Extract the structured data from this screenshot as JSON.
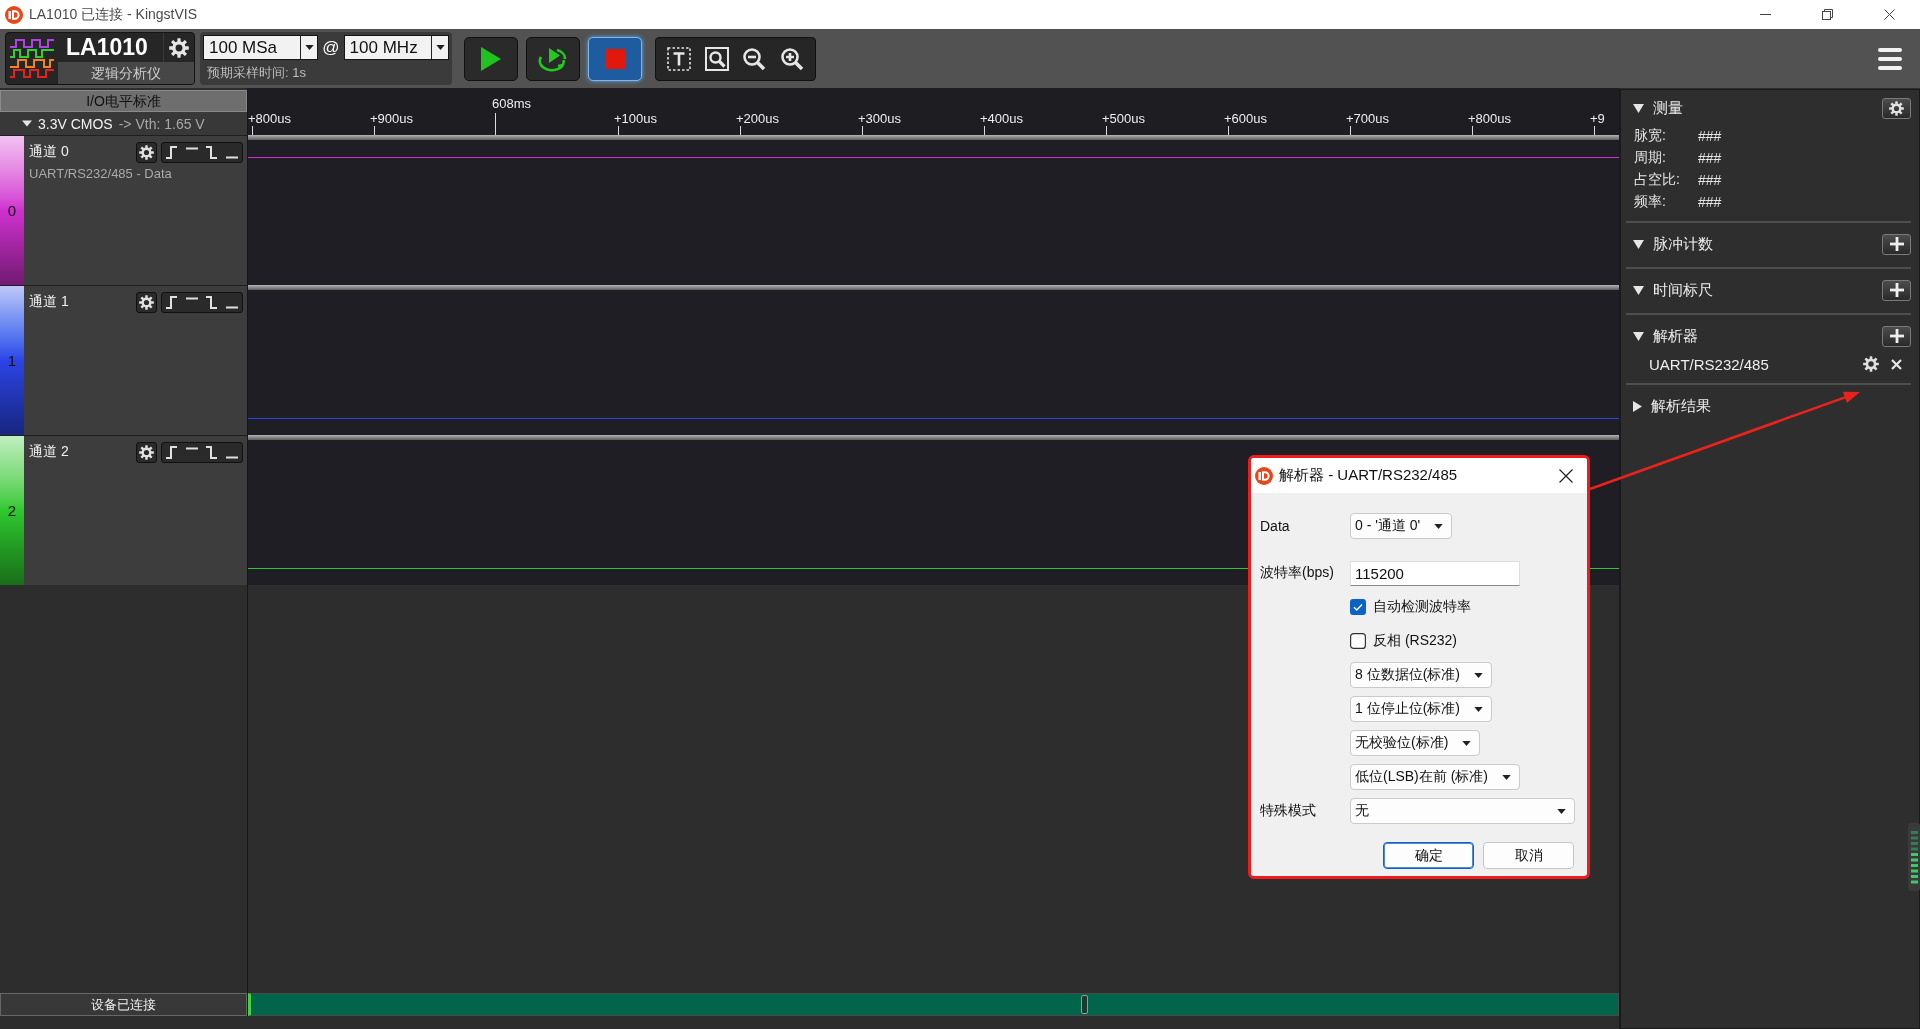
{
  "window": {
    "title": "LA1010 已连接 - KingstVIS"
  },
  "toolbar": {
    "device": "LA1010",
    "device_caption": "逻辑分析仪",
    "sample_depth": "100 MSa",
    "separator": "@",
    "sample_rate": "100 MHz",
    "estimated_time": "预期采样时间: 1s",
    "run_buttons": [
      {
        "kind": "start",
        "active": false
      },
      {
        "kind": "loop",
        "active": false
      },
      {
        "kind": "stop",
        "active": true
      }
    ]
  },
  "io_standard": {
    "title": "I/O电平标准",
    "standard": "3.3V CMOS",
    "threshold": "-> Vth: 1.65 V"
  },
  "ruler": {
    "ticks": [
      {
        "label": "+800us",
        "kind": "minor"
      },
      {
        "label": "+900us",
        "kind": "minor"
      },
      {
        "label": "608ms",
        "kind": "major"
      },
      {
        "label": "+100us",
        "kind": "minor"
      },
      {
        "label": "+200us",
        "kind": "minor"
      },
      {
        "label": "+300us",
        "kind": "minor"
      },
      {
        "label": "+400us",
        "kind": "minor"
      },
      {
        "label": "+500us",
        "kind": "minor"
      },
      {
        "label": "+600us",
        "kind": "minor"
      },
      {
        "label": "+700us",
        "kind": "minor"
      },
      {
        "label": "+800us",
        "kind": "minor"
      },
      {
        "label": "+9",
        "kind": "minor"
      }
    ]
  },
  "channels": [
    {
      "number": "0",
      "name": "通道 0",
      "decoder": "UART/RS232/485 - Data",
      "color": "#d030d0",
      "kind": "high"
    },
    {
      "number": "1",
      "name": "通道 1",
      "color": "#2c44e6",
      "kind": "low"
    },
    {
      "number": "2",
      "name": "通道 2",
      "color": "#2ec82e",
      "kind": "low"
    }
  ],
  "status_bar": {
    "text": "设备已连接"
  },
  "side_panel": {
    "sections": [
      {
        "title": "测量",
        "expanded": true,
        "kind": "settings",
        "rows": [
          {
            "label": "脉宽:",
            "value": "###"
          },
          {
            "label": "周期:",
            "value": "###"
          },
          {
            "label": "占空比:",
            "value": "###"
          },
          {
            "label": "频率:",
            "value": "###"
          }
        ]
      },
      {
        "title": "脉冲计数",
        "expanded": true,
        "kind": "add"
      },
      {
        "title": "时间标尺",
        "expanded": true,
        "kind": "add"
      },
      {
        "title": "解析器",
        "expanded": true,
        "kind": "add",
        "items": [
          {
            "name": "UART/RS232/485"
          }
        ]
      },
      {
        "title": "解析结果",
        "expanded": false,
        "kind": "plain"
      }
    ]
  },
  "decoder_dialog": {
    "title": "解析器 - UART/RS232/485",
    "highlighted": true,
    "fields": [
      {
        "kind": "select",
        "label": "Data",
        "value": "0 - '通道 0'"
      },
      {
        "kind": "input",
        "label": "波特率(bps)",
        "value": "115200"
      },
      {
        "kind": "checkbox",
        "label": "自动检测波特率",
        "checked": true
      },
      {
        "kind": "checkbox",
        "label": "反相 (RS232)",
        "checked": false
      },
      {
        "kind": "select",
        "value": "8 位数据位(标准)"
      },
      {
        "kind": "select",
        "value": "1 位停止位(标准)"
      },
      {
        "kind": "select",
        "value": "无校验位(标准)"
      },
      {
        "kind": "select",
        "value": "低位(LSB)在前 (标准)"
      },
      {
        "kind": "select",
        "label": "特殊模式",
        "value": "无",
        "wide": true
      }
    ],
    "buttons": [
      {
        "label": "确定",
        "default": true
      },
      {
        "label": "取消",
        "default": false
      }
    ]
  }
}
